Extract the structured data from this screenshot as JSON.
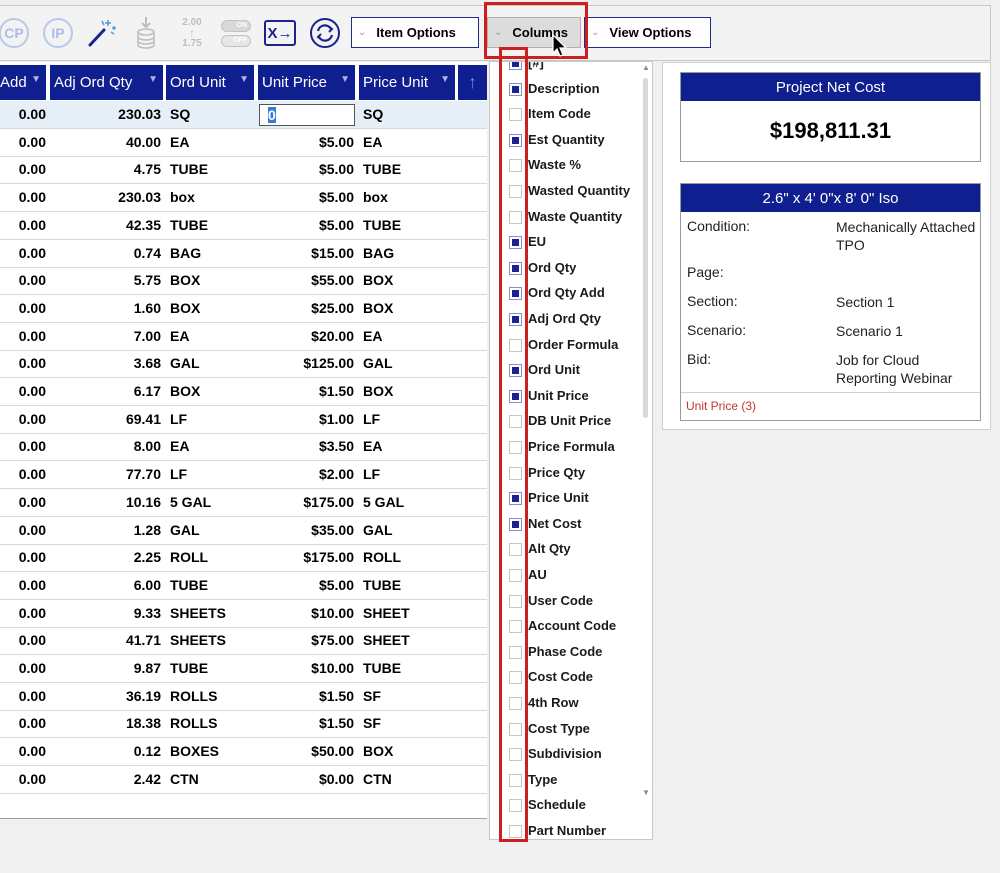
{
  "toolbar": {
    "icons": [
      {
        "name": "cp-icon",
        "text": "CP"
      },
      {
        "name": "ip-icon",
        "text": "IP"
      },
      {
        "name": "magic-wand-icon"
      },
      {
        "name": "database-import-icon"
      },
      {
        "name": "scale-values-icon",
        "top": "2.00",
        "bottom": "1.75"
      },
      {
        "name": "on-off-toggle-icon",
        "on": "ON",
        "off": "OFF"
      },
      {
        "name": "excel-export-icon",
        "text": "X→"
      },
      {
        "name": "refresh-icon"
      }
    ],
    "buttons": {
      "item_options": "Item Options",
      "columns": "Columns",
      "view_options": "View Options"
    }
  },
  "grid": {
    "columns": [
      "Add",
      "Adj Ord Qty",
      "Ord Unit",
      "Unit Price",
      "Price Unit"
    ],
    "editing_value": "0",
    "rows": [
      {
        "add": "0.00",
        "adj": "230.03",
        "ord_unit": "SQ",
        "unit_price": "",
        "price_unit": "SQ"
      },
      {
        "add": "0.00",
        "adj": "40.00",
        "ord_unit": "EA",
        "unit_price": "$5.00",
        "price_unit": "EA"
      },
      {
        "add": "0.00",
        "adj": "4.75",
        "ord_unit": "TUBE",
        "unit_price": "$5.00",
        "price_unit": "TUBE"
      },
      {
        "add": "0.00",
        "adj": "230.03",
        "ord_unit": "box",
        "unit_price": "$5.00",
        "price_unit": "box"
      },
      {
        "add": "0.00",
        "adj": "42.35",
        "ord_unit": "TUBE",
        "unit_price": "$5.00",
        "price_unit": "TUBE"
      },
      {
        "add": "0.00",
        "adj": "0.74",
        "ord_unit": "BAG",
        "unit_price": "$15.00",
        "price_unit": "BAG"
      },
      {
        "add": "0.00",
        "adj": "5.75",
        "ord_unit": "BOX",
        "unit_price": "$55.00",
        "price_unit": "BOX"
      },
      {
        "add": "0.00",
        "adj": "1.60",
        "ord_unit": "BOX",
        "unit_price": "$25.00",
        "price_unit": "BOX"
      },
      {
        "add": "0.00",
        "adj": "7.00",
        "ord_unit": "EA",
        "unit_price": "$20.00",
        "price_unit": "EA"
      },
      {
        "add": "0.00",
        "adj": "3.68",
        "ord_unit": "GAL",
        "unit_price": "$125.00",
        "price_unit": "GAL"
      },
      {
        "add": "0.00",
        "adj": "6.17",
        "ord_unit": "BOX",
        "unit_price": "$1.50",
        "price_unit": "BOX"
      },
      {
        "add": "0.00",
        "adj": "69.41",
        "ord_unit": "LF",
        "unit_price": "$1.00",
        "price_unit": "LF"
      },
      {
        "add": "0.00",
        "adj": "8.00",
        "ord_unit": "EA",
        "unit_price": "$3.50",
        "price_unit": "EA"
      },
      {
        "add": "0.00",
        "adj": "77.70",
        "ord_unit": "LF",
        "unit_price": "$2.00",
        "price_unit": "LF"
      },
      {
        "add": "0.00",
        "adj": "10.16",
        "ord_unit": "5 GAL",
        "unit_price": "$175.00",
        "price_unit": "5 GAL"
      },
      {
        "add": "0.00",
        "adj": "1.28",
        "ord_unit": "GAL",
        "unit_price": "$35.00",
        "price_unit": "GAL"
      },
      {
        "add": "0.00",
        "adj": "2.25",
        "ord_unit": "ROLL",
        "unit_price": "$175.00",
        "price_unit": "ROLL"
      },
      {
        "add": "0.00",
        "adj": "6.00",
        "ord_unit": "TUBE",
        "unit_price": "$5.00",
        "price_unit": "TUBE"
      },
      {
        "add": "0.00",
        "adj": "9.33",
        "ord_unit": "SHEETS",
        "unit_price": "$10.00",
        "price_unit": "SHEET"
      },
      {
        "add": "0.00",
        "adj": "41.71",
        "ord_unit": "SHEETS",
        "unit_price": "$75.00",
        "price_unit": "SHEET"
      },
      {
        "add": "0.00",
        "adj": "9.87",
        "ord_unit": "TUBE",
        "unit_price": "$10.00",
        "price_unit": "TUBE"
      },
      {
        "add": "0.00",
        "adj": "36.19",
        "ord_unit": "ROLLS",
        "unit_price": "$1.50",
        "price_unit": "SF"
      },
      {
        "add": "0.00",
        "adj": "18.38",
        "ord_unit": "ROLLS",
        "unit_price": "$1.50",
        "price_unit": "SF"
      },
      {
        "add": "0.00",
        "adj": "0.12",
        "ord_unit": "BOXES",
        "unit_price": "$50.00",
        "price_unit": "BOX"
      },
      {
        "add": "0.00",
        "adj": "2.42",
        "ord_unit": "CTN",
        "unit_price": "$0.00",
        "price_unit": "CTN"
      }
    ]
  },
  "columns_menu": [
    {
      "label": "[#]",
      "checked": true
    },
    {
      "label": "Description",
      "checked": true
    },
    {
      "label": "Item Code",
      "checked": false
    },
    {
      "label": "Est Quantity",
      "checked": true
    },
    {
      "label": "Waste %",
      "checked": false
    },
    {
      "label": "Wasted Quantity",
      "checked": false
    },
    {
      "label": "Waste Quantity",
      "checked": false
    },
    {
      "label": "EU",
      "checked": true
    },
    {
      "label": "Ord Qty",
      "checked": true
    },
    {
      "label": "Ord Qty Add",
      "checked": true
    },
    {
      "label": "Adj Ord Qty",
      "checked": true
    },
    {
      "label": "Order Formula",
      "checked": false
    },
    {
      "label": "Ord Unit",
      "checked": true
    },
    {
      "label": "Unit Price",
      "checked": true
    },
    {
      "label": "DB Unit Price",
      "checked": false
    },
    {
      "label": "Price Formula",
      "checked": false
    },
    {
      "label": "Price Qty",
      "checked": false
    },
    {
      "label": "Price Unit",
      "checked": true
    },
    {
      "label": "Net Cost",
      "checked": true
    },
    {
      "label": "Alt Qty",
      "checked": false
    },
    {
      "label": "AU",
      "checked": false
    },
    {
      "label": "User Code",
      "checked": false
    },
    {
      "label": "Account Code",
      "checked": false
    },
    {
      "label": "Phase Code",
      "checked": false
    },
    {
      "label": "Cost Code",
      "checked": false
    },
    {
      "label": "4th Row",
      "checked": false
    },
    {
      "label": "Cost Type",
      "checked": false
    },
    {
      "label": "Subdivision",
      "checked": false
    },
    {
      "label": "Type",
      "checked": false
    },
    {
      "label": "Schedule",
      "checked": false
    },
    {
      "label": "Part Number",
      "checked": false
    }
  ],
  "right_panel": {
    "net_cost_title": "Project Net Cost",
    "net_cost_value": "$198,811.31",
    "item_title": "2.6\" x 4' 0\"x 8' 0\" Iso",
    "info": [
      {
        "label": "Condition:",
        "value": "Mechanically Attached TPO"
      },
      {
        "label": "Page:",
        "value": ""
      },
      {
        "label": "Section:",
        "value": "Section 1"
      },
      {
        "label": "Scenario:",
        "value": "Scenario 1"
      },
      {
        "label": "Bid:",
        "value": "Job for Cloud Reporting Webinar"
      }
    ],
    "unit_price_link": "Unit Price (3)"
  },
  "colors": {
    "header_blue": "#0f1f8f",
    "highlight_red": "#cc1f1f",
    "link_red": "#c0392b"
  }
}
